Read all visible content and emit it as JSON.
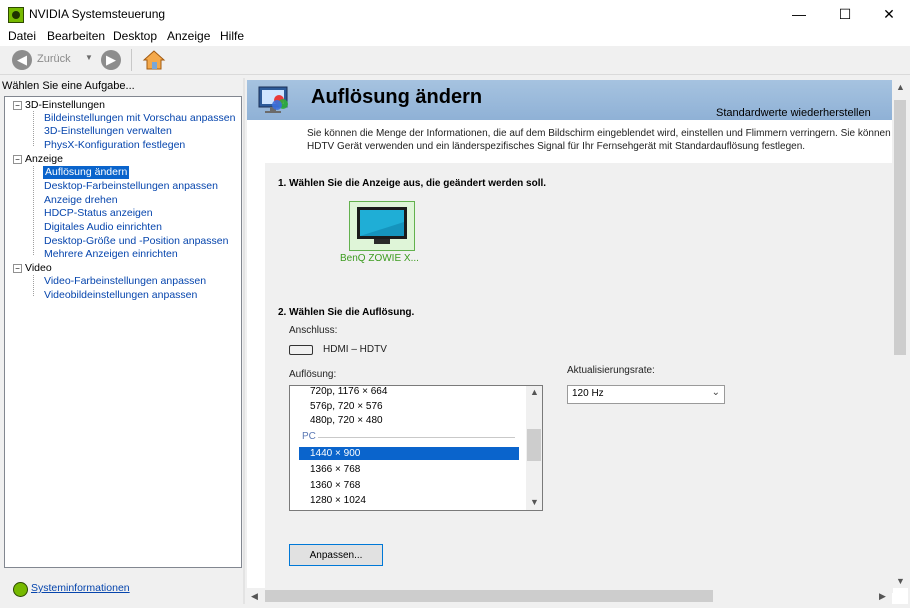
{
  "window": {
    "title": "NVIDIA Systemsteuerung",
    "controls": {
      "minimize": "—",
      "maximize": "☐",
      "close": "✕"
    }
  },
  "menu": [
    "Datei",
    "Bearbeiten",
    "Desktop",
    "Anzeige",
    "Hilfe"
  ],
  "toolbar": {
    "back_label": "Zurück"
  },
  "left_pane": {
    "header": "Wählen Sie eine Aufgabe...",
    "tree": [
      {
        "label": "3D-Einstellungen",
        "level": 0,
        "type": "category"
      },
      {
        "label": "Bildeinstellungen mit Vorschau anpassen",
        "level": 1,
        "type": "link"
      },
      {
        "label": "3D-Einstellungen verwalten",
        "level": 1,
        "type": "link"
      },
      {
        "label": "PhysX-Konfiguration festlegen",
        "level": 1,
        "type": "link"
      },
      {
        "label": "Anzeige",
        "level": 0,
        "type": "category"
      },
      {
        "label": "Auflösung ändern",
        "level": 1,
        "type": "link",
        "selected": true
      },
      {
        "label": "Desktop-Farbeinstellungen anpassen",
        "level": 1,
        "type": "link"
      },
      {
        "label": "Anzeige drehen",
        "level": 1,
        "type": "link"
      },
      {
        "label": "HDCP-Status anzeigen",
        "level": 1,
        "type": "link"
      },
      {
        "label": "Digitales Audio einrichten",
        "level": 1,
        "type": "link"
      },
      {
        "label": "Desktop-Größe und -Position anpassen",
        "level": 1,
        "type": "link"
      },
      {
        "label": "Mehrere Anzeigen einrichten",
        "level": 1,
        "type": "link"
      },
      {
        "label": "Video",
        "level": 0,
        "type": "category"
      },
      {
        "label": "Video-Farbeinstellungen anpassen",
        "level": 1,
        "type": "link"
      },
      {
        "label": "Videobildeinstellungen anpassen",
        "level": 1,
        "type": "link"
      }
    ],
    "system_info": "Systeminformationen"
  },
  "main": {
    "title": "Auflösung ändern",
    "restore_defaults": "Standardwerte wiederherstellen",
    "intro": "Sie können die Menge der Informationen, die auf dem Bildschirm eingeblendet wird, einstellen und Flimmern verringern. Sie können HDTV Gerät verwenden und ein länderspezifisches Signal für Ihr Fernsehgerät mit Standardauflösung festlegen.",
    "section1": "1. Wählen Sie die Anzeige aus, die geändert werden soll.",
    "display_name": "BenQ ZOWIE X...",
    "section2": "2. Wählen Sie die Auflösung.",
    "connection_label": "Anschluss:",
    "connection_value": "HDMI – HDTV",
    "resolution_label": "Auflösung:",
    "resolutions": [
      {
        "label": "720p, 1176 × 664"
      },
      {
        "label": "576p, 720 × 576"
      },
      {
        "label": "480p, 720 × 480"
      },
      {
        "label": "1440 × 900",
        "selected": true
      },
      {
        "label": "1366 × 768"
      },
      {
        "label": "1360 × 768"
      },
      {
        "label": "1280 × 1024"
      }
    ],
    "resolution_group": "PC",
    "refresh_label": "Aktualisierungsrate:",
    "refresh_value": "120 Hz",
    "customize_button": "Anpassen..."
  },
  "colors": {
    "nvidia_green": "#76b900",
    "selection_blue": "#0a64cc",
    "link_blue": "#0645ad",
    "banner_blue": "#9bbbdd"
  }
}
